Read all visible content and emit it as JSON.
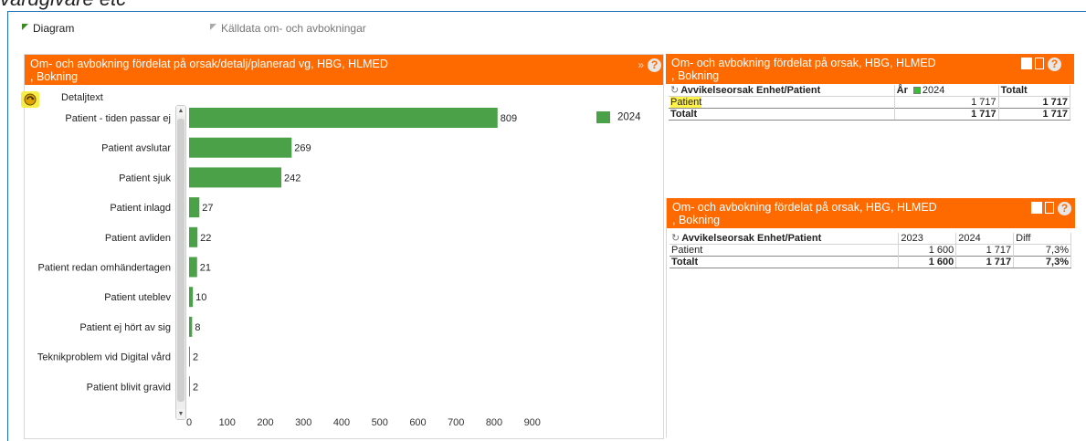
{
  "page_title": "vårdgivare etc",
  "tabs": [
    {
      "label": "Diagram"
    },
    {
      "label": "Källdata om- och avbokningar"
    }
  ],
  "chart_panel": {
    "title": "Om- och avbokning fördelat på orsak/detalj/planerad vg, HBG, HLMED\n, Bokning",
    "detail_label": "Detaljtext",
    "help_icon": "help-icon"
  },
  "chart_data": {
    "type": "bar",
    "orientation": "horizontal",
    "categories": [
      "Patient - tiden passar ej",
      "Patient avslutar",
      "Patient sjuk",
      "Patient inlagd",
      "Patient avliden",
      "Patient redan omhändertagen",
      "Patient uteblev",
      "Patient ej hört av sig",
      "Teknikproblem vid Digital vård",
      "Patient blivit gravid"
    ],
    "series": [
      {
        "name": "2024",
        "values": [
          809,
          269,
          242,
          27,
          22,
          21,
          10,
          8,
          2,
          2
        ],
        "color": "#4aa147"
      }
    ],
    "xlim": [
      0,
      900
    ],
    "xticks": [
      0,
      100,
      200,
      300,
      400,
      500,
      600,
      700,
      800,
      900
    ],
    "legend_position": "top-right",
    "grid": false
  },
  "table1": {
    "title": "Om- och avbokning fördelat på orsak, HBG, HLMED\n, Bokning",
    "headers": {
      "dim": "Avvikelseorsak Enhet/Patient",
      "year_label": "År",
      "year": "2024",
      "total": "Totalt"
    },
    "rows": [
      {
        "label": "Patient",
        "v2024": "1 717",
        "total": "1 717"
      }
    ],
    "total_row": {
      "label": "Totalt",
      "v2024": "1 717",
      "total": "1 717"
    }
  },
  "table2": {
    "title": "Om- och avbokning fördelat på orsak, HBG, HLMED\n, Bokning",
    "headers": {
      "dim": "Avvikelseorsak Enhet/Patient",
      "y2023": "2023",
      "y2024": "2024",
      "diff": "Diff"
    },
    "rows": [
      {
        "label": "Patient",
        "v2023": "1 600",
        "v2024": "1 717",
        "diff": "7,3%"
      }
    ],
    "total_row": {
      "label": "Totalt",
      "v2023": "1 600",
      "v2024": "1 717",
      "diff": "7,3%"
    }
  }
}
